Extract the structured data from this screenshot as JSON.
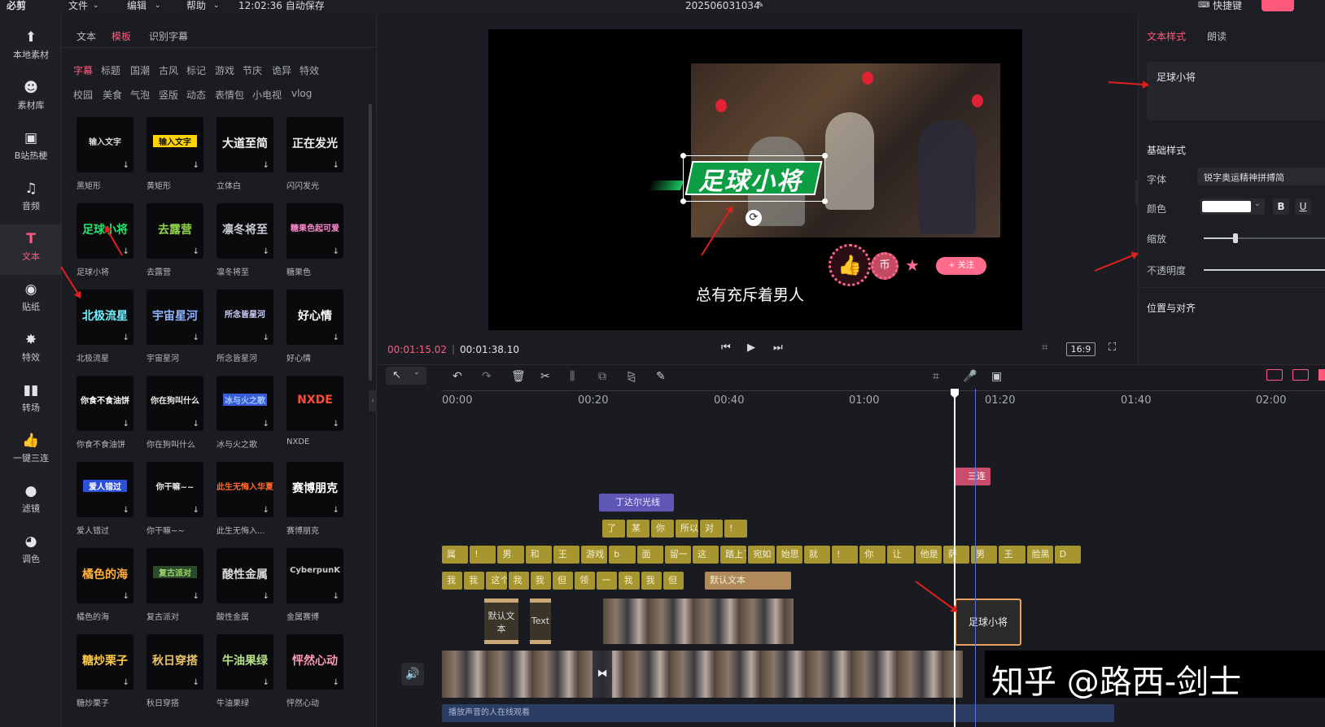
{
  "topbar": {
    "app_name": "必剪",
    "menu_file": "文件",
    "menu_edit": "编辑",
    "menu_help": "帮助",
    "autosave": "12:02:36 自动保存",
    "project_name": "202506031034",
    "shortcuts": "快捷键"
  },
  "rail": [
    {
      "label": "本地素材",
      "icon": "folder-upload-icon"
    },
    {
      "label": "素材库",
      "icon": "library-icon"
    },
    {
      "label": "B站热梗",
      "icon": "bilibili-tv-icon"
    },
    {
      "label": "音频",
      "icon": "music-note-icon"
    },
    {
      "label": "文本",
      "icon": "text-icon"
    },
    {
      "label": "贴纸",
      "icon": "sticker-icon"
    },
    {
      "label": "特效",
      "icon": "effect-star-icon"
    },
    {
      "label": "转场",
      "icon": "transition-icon"
    },
    {
      "label": "一键三连",
      "icon": "thumbs-up-icon"
    },
    {
      "label": "滤镜",
      "icon": "filter-icon"
    },
    {
      "label": "调色",
      "icon": "palette-icon"
    }
  ],
  "panel": {
    "tabs": [
      "文本",
      "模板",
      "识别字幕"
    ],
    "categories_row1": [
      "字幕",
      "标题",
      "国潮",
      "古风",
      "标记",
      "游戏",
      "节庆",
      "诡异",
      "特效"
    ],
    "categories_row2": [
      "校园",
      "美食",
      "气泡",
      "竖版",
      "动态",
      "表情包",
      "小电视",
      "vlog"
    ],
    "templates": [
      {
        "label": "黑矩形",
        "preview": "输入文字",
        "color": "#d9d9d9",
        "bg": "#0b0b0d"
      },
      {
        "label": "黄矩形",
        "preview": "输入文字",
        "color": "#111111",
        "bg": "#ffd400"
      },
      {
        "label": "立体白",
        "preview": "大道至简",
        "color": "#f2f2f2",
        "bg": ""
      },
      {
        "label": "闪闪发光",
        "preview": "正在发光",
        "color": "#f0f0f0",
        "bg": ""
      },
      {
        "label": "足球小将",
        "preview": "足球小将",
        "color": "#23e36b",
        "bg": ""
      },
      {
        "label": "去露营",
        "preview": "去露营",
        "color": "#8fd34a",
        "bg": ""
      },
      {
        "label": "凛冬将至",
        "preview": "凛冬将至",
        "color": "#c8ccd6",
        "bg": ""
      },
      {
        "label": "糖果色",
        "preview": "糖果色起可爱",
        "color": "#ff8ad1",
        "bg": ""
      },
      {
        "label": "北极流星",
        "preview": "北极流星",
        "color": "#6ef2ff",
        "bg": ""
      },
      {
        "label": "宇宙星河",
        "preview": "宇宙星河",
        "color": "#8fb4ff",
        "bg": ""
      },
      {
        "label": "所念皆星河",
        "preview": "所念皆星河",
        "color": "#cfd3ff",
        "bg": ""
      },
      {
        "label": "好心情",
        "preview": "好心情",
        "color": "#ffffff",
        "bg": ""
      },
      {
        "label": "你食不食油饼",
        "preview": "你食不食油饼",
        "color": "#ffffff",
        "bg": ""
      },
      {
        "label": "你在狗叫什么",
        "preview": "你在狗叫什么",
        "color": "#e8e8e8",
        "bg": ""
      },
      {
        "label": "冰与火之歌",
        "preview": "冰与火之歌",
        "color": "#9ec7ff",
        "bg": "#3a5bd8"
      },
      {
        "label": "NXDE",
        "preview": "NXDE",
        "color": "#ff4a3a",
        "bg": ""
      },
      {
        "label": "爱人错过",
        "preview": "爱人错过",
        "color": "#ffffff",
        "bg": "#2a4fd8"
      },
      {
        "label": "你干嘛~~",
        "preview": "你干嘛~~",
        "color": "#e8e8e8",
        "bg": ""
      },
      {
        "label": "此生无悔入...",
        "preview": "此生无悔入华夏",
        "color": "#ff6a2a",
        "bg": ""
      },
      {
        "label": "赛博朋克",
        "preview": "赛博朋克",
        "color": "#ffffff",
        "bg": ""
      },
      {
        "label": "橘色的海",
        "preview": "橘色的海",
        "color": "#ffb03a",
        "bg": ""
      },
      {
        "label": "复古派对",
        "preview": "复古派对",
        "color": "#9bd86b",
        "bg": "#2d4a2a"
      },
      {
        "label": "酸性金属",
        "preview": "酸性金属",
        "color": "#d8d8d8",
        "bg": ""
      },
      {
        "label": "金属赛博",
        "preview": "CyberpunK",
        "color": "#c9c9c9",
        "bg": ""
      },
      {
        "label": "糖炒栗子",
        "preview": "糖炒栗子",
        "color": "#ffcc4a",
        "bg": ""
      },
      {
        "label": "秋日穿搭",
        "preview": "秋日穿搭",
        "color": "#e9c46a",
        "bg": ""
      },
      {
        "label": "牛油果绿",
        "preview": "牛油果绿",
        "color": "#b8e08a",
        "bg": ""
      },
      {
        "label": "怦然心动",
        "preview": "怦然心动",
        "color": "#ff9ab5",
        "bg": ""
      }
    ]
  },
  "viewer": {
    "title_text": "足球小将",
    "subtitle": "总有充斥着男人",
    "follow_btn": "+ 关注",
    "current_time": "00:01:15.02",
    "total_time": "00:01:38.10",
    "aspect": "16:9"
  },
  "props": {
    "tabs": [
      "文本样式",
      "朗读"
    ],
    "text_value": "足球小将",
    "section_basic": "基础样式",
    "font_label": "字体",
    "font_value": "锐字奥运精神拼搏简",
    "color_label": "颜色",
    "scale_label": "缩放",
    "opacity_label": "不透明度",
    "align_label": "位置与对齐",
    "bold": "B",
    "underline": "U"
  },
  "timeline": {
    "ticks": [
      "00:00",
      "00:20",
      "00:40",
      "01:00",
      "01:20",
      "01:40",
      "02:00"
    ],
    "sticker_clip": "丁达尔光线",
    "sanlian_clip": "三连",
    "text_row1": [
      "了",
      "某",
      "你",
      "所以",
      "对",
      "!"
    ],
    "text_row2": [
      "属",
      "!",
      "男",
      "和",
      "王",
      "游戏",
      "b",
      "面",
      "留一",
      "这",
      "踏上了",
      "宛如",
      "始思",
      "就",
      "!",
      "你",
      "让",
      "他是",
      "萨",
      "男",
      "王",
      "脸黑",
      "D"
    ],
    "text_row3": [
      "我",
      "我",
      "这个",
      "我",
      "我",
      "但",
      "领",
      "一",
      "我",
      "我",
      "但"
    ],
    "default_text_clip": "默认文本",
    "tmpl_clip1": "默认文本",
    "tmpl_clip2": "Text",
    "selected_clip": "足球小将",
    "audio_label": "播放声音的人在线观看",
    "watermark": "知乎 @路西-剑士"
  },
  "colors": {
    "accent": "#ff5a7e",
    "text_clip": "#a7952f",
    "selected_border": "#e8a060",
    "background": "#17181d"
  }
}
